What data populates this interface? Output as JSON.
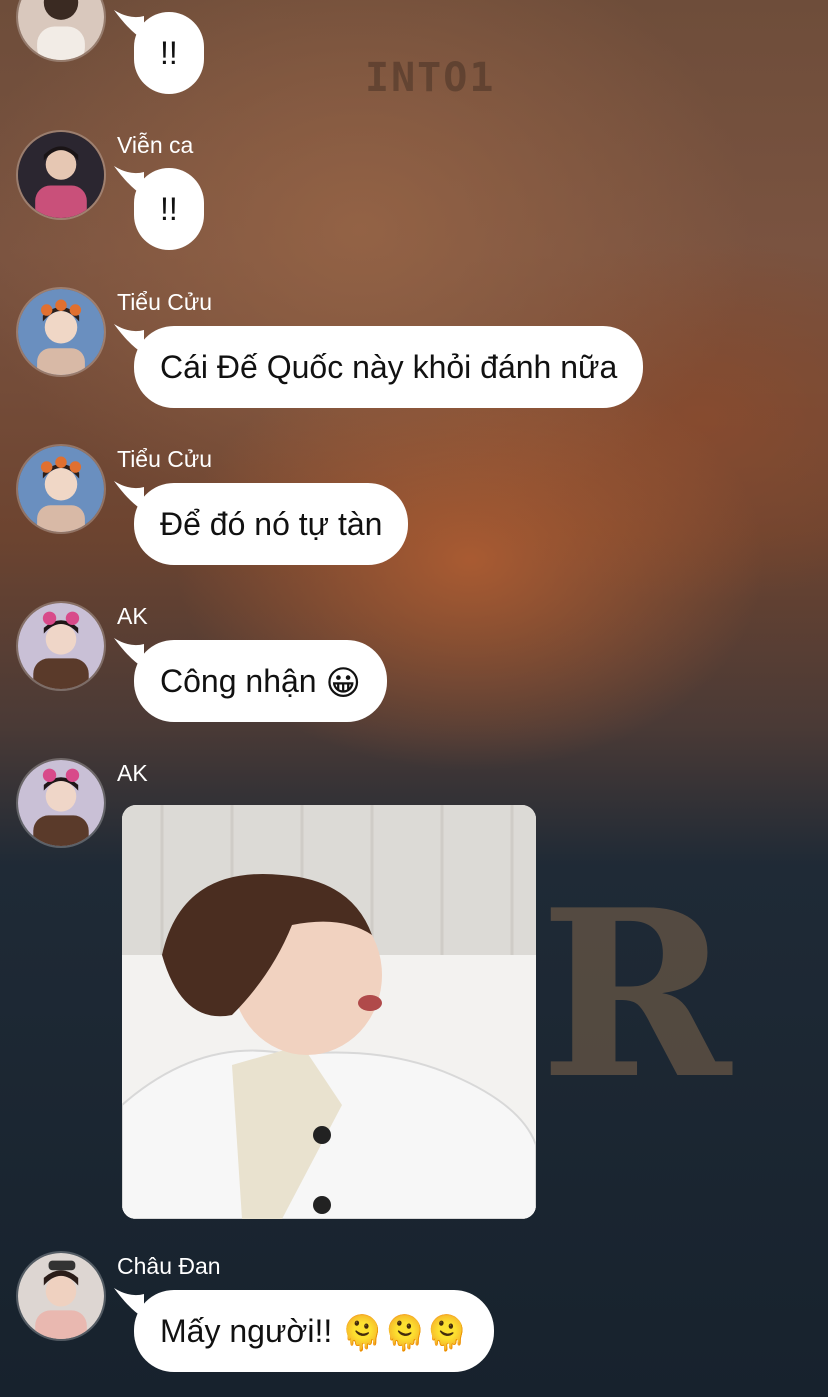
{
  "wallpaper": {
    "text_top": "INTO1",
    "text_large": "R"
  },
  "messages": [
    {
      "sender": "",
      "text": "!!",
      "avatar_icon": "profile-photo"
    },
    {
      "sender": "Viễn ca",
      "text": "!!",
      "avatar_icon": "profile-photo"
    },
    {
      "sender": "Tiểu Cửu",
      "text": "Cái Đế Quốc này khỏi đánh nữa",
      "avatar_icon": "profile-photo"
    },
    {
      "sender": "Tiểu Cửu",
      "text": "Để đó nó tự tàn",
      "avatar_icon": "profile-photo"
    },
    {
      "sender": "AK",
      "text": "Công nhận",
      "emoji": "😀",
      "avatar_icon": "profile-photo"
    },
    {
      "sender": "AK",
      "attachment": "photo",
      "avatar_icon": "profile-photo"
    },
    {
      "sender": "Châu Đan",
      "text": "Mấy người!!",
      "emoji": "🫠🫠🫠",
      "avatar_icon": "profile-photo"
    }
  ],
  "colors": {
    "bubble": "#ffffff",
    "sender_name": "#ffffff",
    "message_text": "#111111"
  }
}
